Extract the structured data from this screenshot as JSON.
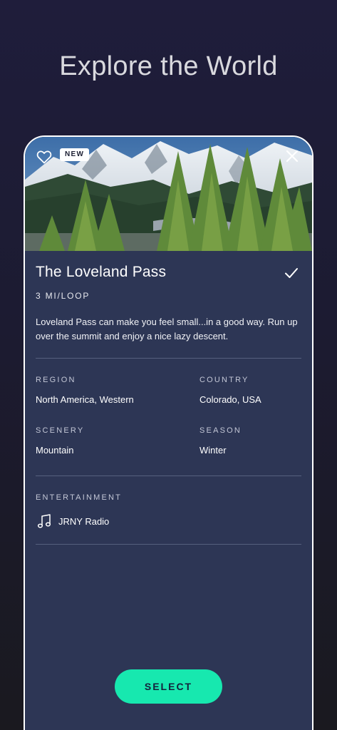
{
  "header": {
    "title": "Explore the World"
  },
  "card": {
    "badge": "NEW",
    "title": "The Loveland Pass",
    "distance": "3 MI/LOOP",
    "description": "Loveland Pass can make you feel small...in a good way. Run up over the summit and enjoy a nice lazy descent.",
    "details": {
      "region_label": "REGION",
      "region_value": "North America, Western",
      "country_label": "COUNTRY",
      "country_value": "Colorado, USA",
      "scenery_label": "SCENERY",
      "scenery_value": "Mountain",
      "season_label": "SEASON",
      "season_value": "Winter"
    },
    "entertainment": {
      "label": "ENTERTAINMENT",
      "value": "JRNY Radio",
      "icon": "music-note-icon"
    },
    "select_label": "SELECT"
  },
  "icons": {
    "favorite": "heart-outline-icon",
    "close": "close-icon",
    "selected": "checkmark-icon"
  },
  "colors": {
    "background": "#1f1d3b",
    "card": "#2d3655",
    "accent": "#17e8af"
  }
}
